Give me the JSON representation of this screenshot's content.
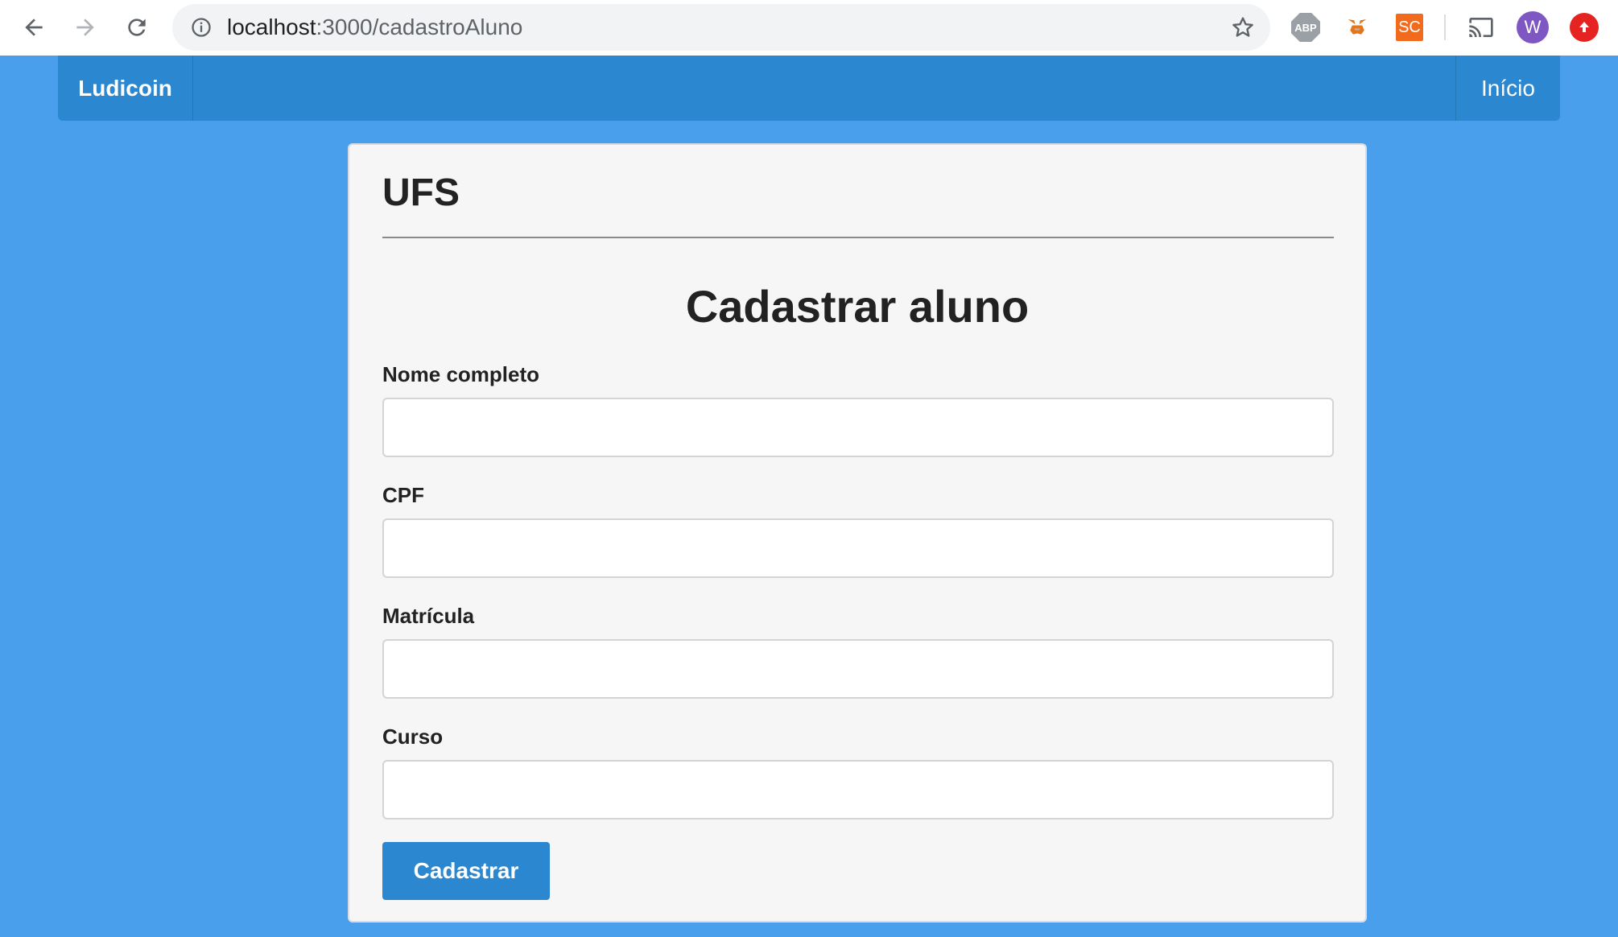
{
  "browser": {
    "url_host": "localhost",
    "url_path": ":3000/cadastroAluno",
    "extensions": {
      "abp_label": "ABP",
      "sc_label": "SC",
      "avatar_letter": "W"
    }
  },
  "navbar": {
    "brand": "Ludicoin",
    "home_link": "Início"
  },
  "card": {
    "org": "UFS",
    "title": "Cadastrar aluno",
    "fields": [
      {
        "label": "Nome completo",
        "value": ""
      },
      {
        "label": "CPF",
        "value": ""
      },
      {
        "label": "Matrícula",
        "value": ""
      },
      {
        "label": "Curso",
        "value": ""
      }
    ],
    "submit_label": "Cadastrar"
  },
  "colors": {
    "page_background": "#4a9fed",
    "navbar": "#2b88d0",
    "button": "#2b88d0",
    "card": "#f6f6f6"
  }
}
